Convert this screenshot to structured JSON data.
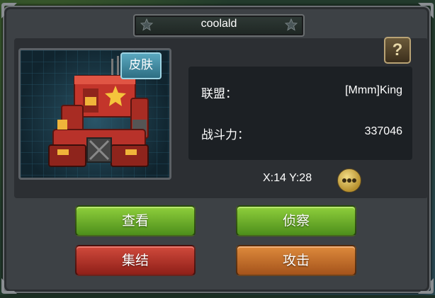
{
  "dialog": {
    "title": "coolald",
    "help_icon_text": "?",
    "skin_button": "皮肤",
    "alliance_label": "联盟：",
    "alliance_value": "[Mmm]King",
    "power_label": "战斗力：",
    "power_value": "337046",
    "coords": "X:14 Y:28"
  },
  "actions": {
    "view": "查看",
    "scout": "侦察",
    "rally": "集结",
    "attack": "攻击"
  },
  "colors": {
    "green_button": "#6fb02b",
    "red_button": "#b5352a",
    "orange_button": "#c8712c",
    "panel": "#1c2024"
  },
  "icons": [
    "star-icon",
    "help-icon",
    "more-icon",
    "robot-portrait"
  ]
}
